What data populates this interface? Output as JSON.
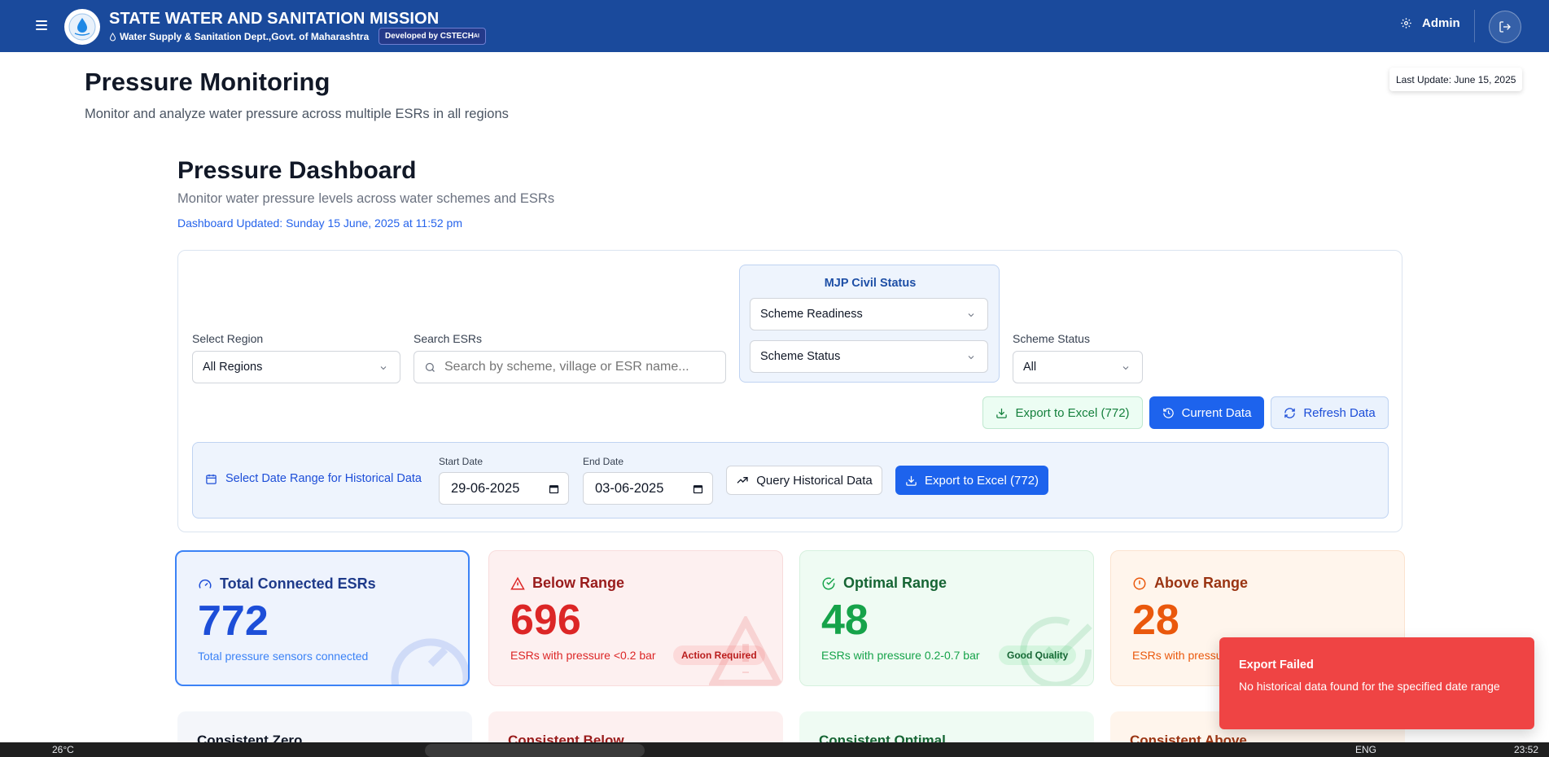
{
  "header": {
    "title": "STATE WATER AND SANITATION MISSION",
    "subtitle": "Water Supply & Sanitation Dept.,Govt. of Maharashtra",
    "developed_by": "Developed by CSTECH",
    "developed_by_suffix": "AI",
    "user": "Admin"
  },
  "page": {
    "title": "Pressure Monitoring",
    "subtitle": "Monitor and analyze water pressure across multiple ESRs in all regions",
    "last_update": "Last Update: June 15, 2025"
  },
  "dashboard": {
    "title": "Pressure Dashboard",
    "subtitle": "Monitor water pressure levels across water schemes and ESRs",
    "updated": "Dashboard Updated: Sunday 15 June, 2025 at 11:52 pm"
  },
  "filters": {
    "region_label": "Select Region",
    "region_value": "All Regions",
    "search_label": "Search ESRs",
    "search_placeholder": "Search by scheme, village or ESR name...",
    "mjp_title": "MJP Civil Status",
    "scheme_readiness": "Scheme Readiness",
    "scheme_status_select": "Scheme Status",
    "scheme_status_label": "Scheme Status",
    "scheme_status_value": "All",
    "export_label": "Export to Excel (772)",
    "current_label": "Current Data",
    "refresh_label": "Refresh Data"
  },
  "historical": {
    "label": "Select Date Range for Historical Data",
    "start_label": "Start Date",
    "start_value": "29-06-2025",
    "end_label": "End Date",
    "end_value": "03-06-2025",
    "query_label": "Query Historical Data",
    "export_label": "Export to Excel (772)"
  },
  "cards": [
    {
      "title": "Total Connected ESRs",
      "value": "772",
      "desc": "Total pressure sensors connected",
      "color": "#1d4ed8"
    },
    {
      "title": "Below Range",
      "value": "696",
      "desc": "ESRs with pressure <0.2 bar",
      "tag": "Action Required",
      "color": "#dc2626"
    },
    {
      "title": "Optimal Range",
      "value": "48",
      "desc": "ESRs with pressure 0.2-0.7 bar",
      "tag": "Good Quality",
      "color": "#16a34a"
    },
    {
      "title": "Above Range",
      "value": "28",
      "desc": "ESRs with pressu",
      "color": "#ea580c"
    }
  ],
  "row2": [
    "Consistent Zero",
    "Consistent Below",
    "Consistent Optimal",
    "Consistent Above"
  ],
  "toast": {
    "title": "Export Failed",
    "message": "No historical data found for the specified date range"
  },
  "taskbar": {
    "weather": "26°C",
    "lang": "ENG",
    "time": "23:52"
  }
}
